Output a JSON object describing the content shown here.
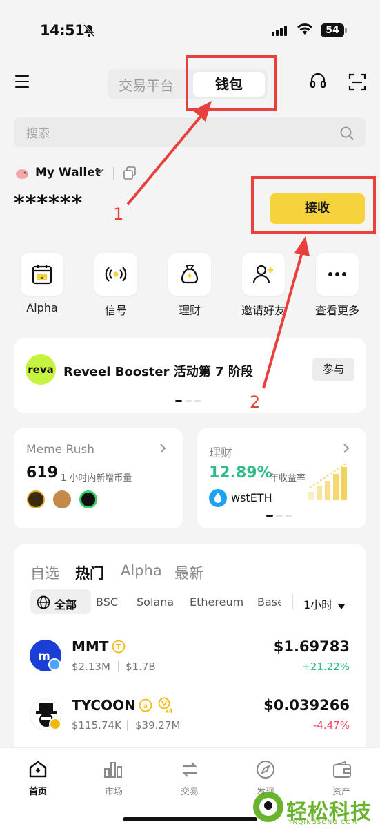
{
  "status_bar": {
    "time": "14:51",
    "battery": "54"
  },
  "header": {
    "tab_exchange": "交易平台",
    "tab_wallet": "钱包"
  },
  "search": {
    "placeholder": "搜索"
  },
  "wallet": {
    "name": "My Wallet",
    "balance": "******",
    "receive_label": "接收"
  },
  "quick_actions": [
    {
      "label": "Alpha",
      "icon": "calendar-alpha-icon"
    },
    {
      "label": "信号",
      "icon": "signal-broadcast-icon"
    },
    {
      "label": "理财",
      "icon": "money-bag-icon"
    },
    {
      "label": "邀请好友",
      "icon": "invite-user-icon"
    },
    {
      "label": "查看更多",
      "icon": "more-dots-icon"
    }
  ],
  "banner": {
    "logo_text": "reva",
    "title": "Reveel Booster 活动第 7 阶段",
    "button": "参与"
  },
  "meme_card": {
    "title": "Meme Rush",
    "count": "619",
    "subtitle": "1 小时内新增币量"
  },
  "earn_card": {
    "title": "理财",
    "rate": "12.89%",
    "subtitle": "年收益率",
    "asset": "wstETH"
  },
  "market": {
    "tabs": [
      "自选",
      "热门",
      "Alpha",
      "最新"
    ],
    "active_tab": "热门",
    "chains": [
      "全部",
      "BSC",
      "Solana",
      "Ethereum",
      "Base"
    ],
    "timeframe": "1小时",
    "rows": [
      {
        "name": "MMT",
        "volume": "$2.13M",
        "mcap": "$1.7B",
        "price": "$1.69783",
        "change": "+21.22%",
        "change_color": "#2ebd85"
      },
      {
        "name": "TYCOON",
        "volume": "$115.74K",
        "mcap": "$39.27M",
        "price": "$0.039266",
        "change": "-4.47%",
        "change_color": "#f6465d"
      }
    ]
  },
  "bottom_nav": [
    {
      "label": "首页",
      "active": true
    },
    {
      "label": "市场"
    },
    {
      "label": "交易"
    },
    {
      "label": "发现"
    },
    {
      "label": "资产"
    }
  ],
  "annotations": {
    "one": "1",
    "two": "2"
  },
  "watermark": {
    "text": "轻松科技",
    "sub": "YNQINGSONG.COM"
  },
  "colors": {
    "accent": "#f6d33c",
    "annotation": "#e8413d",
    "up": "#2ebd85",
    "down": "#f6465d"
  }
}
